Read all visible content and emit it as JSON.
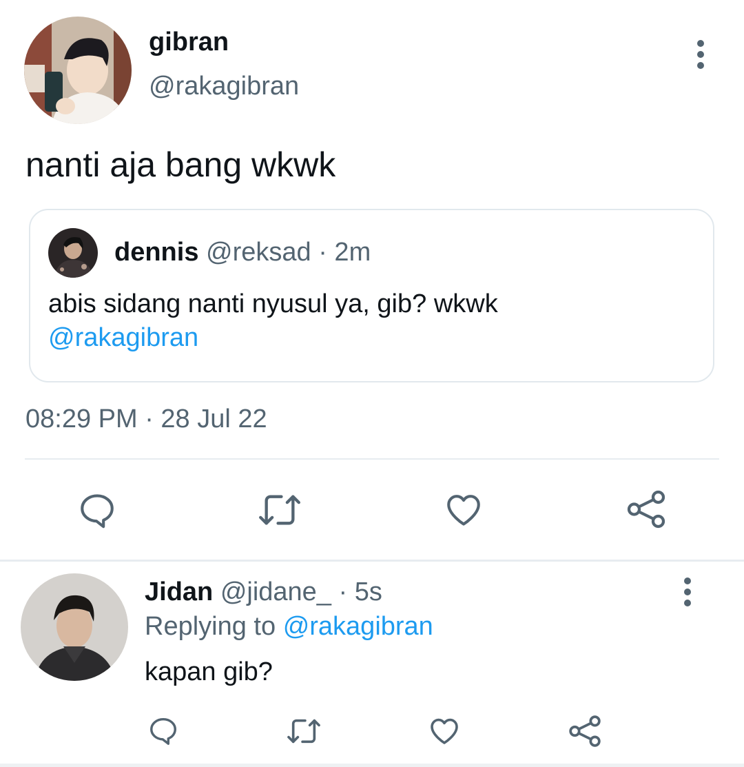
{
  "main_tweet": {
    "name": "gibran",
    "handle": "@rakagibran",
    "text": "nanti aja bang wkwk",
    "timestamp": "08:29 PM · 28 Jul 22",
    "actions": [
      "reply-icon",
      "retweet-icon",
      "like-icon",
      "share-icon"
    ]
  },
  "quoted_tweet": {
    "name": "dennis",
    "handle_time": "@reksad · 2m",
    "text": "abis sidang nanti nyusul ya, gib? wkwk",
    "mention": "@rakagibran"
  },
  "reply_tweet": {
    "name": "Jidan",
    "handle_time": "@jidane_ · 5s",
    "replying_prefix": "Replying to",
    "replying_to": "@rakagibran",
    "text": "kapan gib?",
    "actions": [
      "reply-icon",
      "retweet-icon",
      "like-icon",
      "share-icon"
    ]
  },
  "colors": {
    "text": "#0f1419",
    "secondary": "#536471",
    "link": "#1d9bf0",
    "border": "#e1e8ed"
  }
}
